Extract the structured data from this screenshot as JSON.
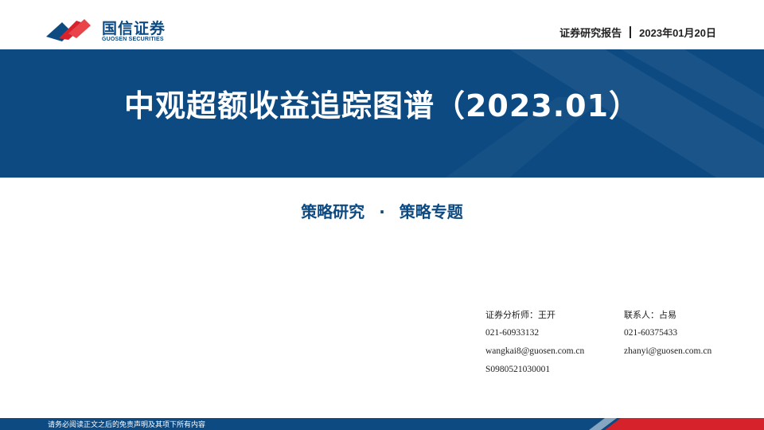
{
  "header": {
    "logo_cn": "国信证券",
    "logo_en": "GUOSEN SECURITIES",
    "report_type": "证券研究报告",
    "date": "2023年01月20日"
  },
  "title": "中观超额收益追踪图谱（2023.01）",
  "subtitle": {
    "left": "策略研究",
    "dot": "·",
    "right": "策略专题"
  },
  "analyst": {
    "label": "证券分析师：王开",
    "phone": "021-60933132",
    "email": "wangkai8@guosen.com.cn",
    "license": "S0980521030001"
  },
  "contact": {
    "label": "联系人：占易",
    "phone": "021-60375433",
    "email": "zhanyi@guosen.com.cn"
  },
  "footer": {
    "disclaimer": "请务必阅读正文之后的免责声明及其项下所有内容"
  },
  "colors": {
    "brand_blue": "#0d4a82",
    "brand_red": "#d6222a"
  }
}
